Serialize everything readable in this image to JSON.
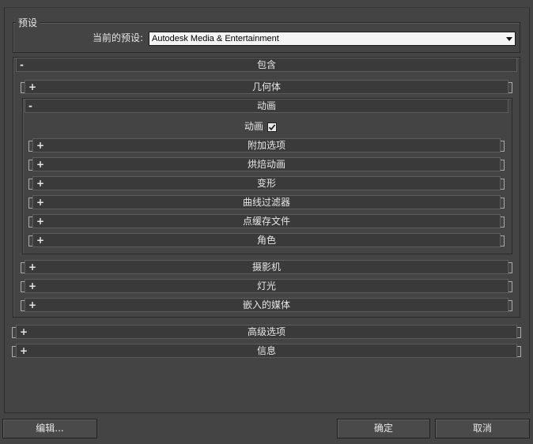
{
  "preset": {
    "group_title": "预设",
    "current_label": "当前的预设:",
    "current_value": "Autodesk Media & Entertainment"
  },
  "sections": {
    "include": {
      "sign": "-",
      "label": "包含"
    },
    "geometry": {
      "sign": "+",
      "label": "几何体"
    },
    "animation": {
      "sign": "-",
      "label": "动画"
    },
    "animation_checkbox_label": "动画",
    "animation_checked": true,
    "extra_options": {
      "sign": "+",
      "label": "附加选项"
    },
    "bake_animation": {
      "sign": "+",
      "label": "烘焙动画"
    },
    "deformations": {
      "sign": "+",
      "label": "变形"
    },
    "curve_filters": {
      "sign": "+",
      "label": "曲线过滤器"
    },
    "point_cache": {
      "sign": "+",
      "label": "点缓存文件"
    },
    "characters": {
      "sign": "+",
      "label": "角色"
    },
    "cameras": {
      "sign": "+",
      "label": "摄影机"
    },
    "lights": {
      "sign": "+",
      "label": "灯光"
    },
    "embed_media": {
      "sign": "+",
      "label": "嵌入的媒体"
    },
    "advanced": {
      "sign": "+",
      "label": "高级选项"
    },
    "info": {
      "sign": "+",
      "label": "信息"
    }
  },
  "buttons": {
    "edit": "编辑...",
    "ok": "确定",
    "cancel": "取消"
  }
}
